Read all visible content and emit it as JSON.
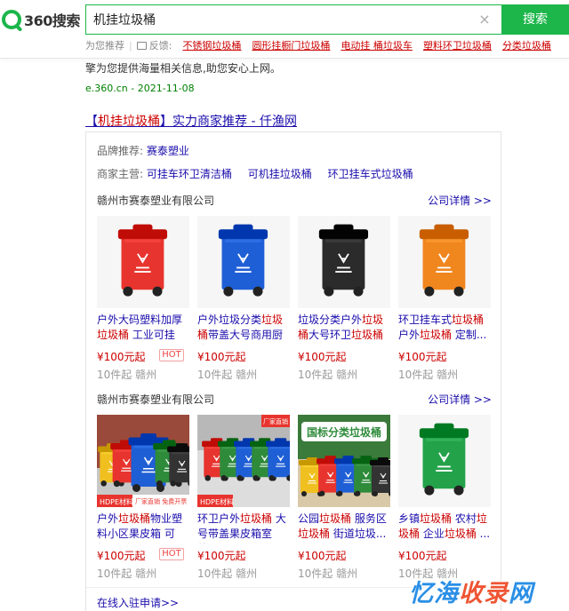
{
  "brand": {
    "logo_text": "360搜索",
    "accent": "#1cb64a"
  },
  "search": {
    "query": "机挂垃圾桶",
    "button_label": "搜索",
    "clear_glyph": "×"
  },
  "suggest": {
    "label": "为您推荐",
    "separator": "|",
    "feedback_label": "反馈:",
    "items": [
      "不锈钢垃圾桶",
      "圆形挂橱门垃圾桶",
      "电动挂 桶垃圾车",
      "塑料环卫垃圾桶",
      "分类垃圾桶"
    ]
  },
  "previous_result": {
    "snippet_line1": "大了机挂垃圾桶,已经为您筛选出更多优质商家信息。360搜索,300精。国内安全的搜索引",
    "snippet_line2": "擎为您提供海量相关信息,助您安心上网。",
    "url": "e.360.cn - 2021-11-08"
  },
  "result": {
    "title_prefix": "【",
    "title_keyword": "机挂垃圾桶",
    "title_suffix": "】实力商家推荐 - 仟渔网",
    "brand_label": "品牌推荐:",
    "brand_value": "赛泰塑业",
    "business_label": "商家主营:",
    "business_items": [
      "可挂车环卫清洁桶",
      "可机挂垃圾桶",
      "环卫挂车式垃圾桶"
    ],
    "footer_link": "在线入驻申请>>"
  },
  "companies": [
    {
      "name": "赣州市赛泰塑业有限公司",
      "more": "公司详情 >>",
      "products": [
        {
          "title_a": "户外大码塑料加厚垃圾桶 工业可挂车...",
          "price": "¥100元起",
          "hot": "HOT",
          "location": "10件起 赣州",
          "color": "#e8342e",
          "image": "bin"
        },
        {
          "title_a": "户外垃圾分类垃圾桶带盖大号商用厨余...",
          "price": "¥100元起",
          "hot": "",
          "location": "10件起 赣州",
          "color": "#1f5fd6",
          "image": "bin"
        },
        {
          "title_a": "垃圾分类户外垃圾桶大号环卫垃圾桶 ...",
          "price": "¥100元起",
          "hot": "",
          "location": "10件起 赣州",
          "color": "#2b2b2b",
          "image": "bin"
        },
        {
          "title_a": "环卫挂车式垃圾桶户外垃圾桶 定制...",
          "price": "¥100元起",
          "hot": "",
          "location": "10件起 赣州",
          "color": "#f0861e",
          "image": "bin"
        }
      ]
    },
    {
      "name": "赣州市赛泰塑业有限公司",
      "more": "公司详情 >>",
      "products": [
        {
          "title_a": "户外垃圾桶物业塑料小区果皮箱 可机...",
          "price": "¥100元起",
          "hot": "HOT",
          "location": "10件起 赣州",
          "color": "#1f5fd6",
          "image": "group",
          "tag": "HDPE材料",
          "tag2": "厂家直销 免费开票"
        },
        {
          "title_a": "环卫户外垃圾桶 大号带盖果皮箱室外...",
          "price": "¥100元起",
          "hot": "",
          "location": "10件起 赣州",
          "color": "#2e8b3a",
          "image": "group2",
          "tag": "HDPE材料",
          "tag2": "厂家直销"
        },
        {
          "title_a": "公园垃圾桶 服务区垃圾桶 街道垃圾...",
          "price": "¥100元起",
          "hot": "",
          "location": "10件起 赣州",
          "color": "#2e9b3a",
          "image": "group3",
          "banner": "国标分类垃圾桶"
        },
        {
          "title_a": "乡镇垃圾桶 农村垃圾桶 企业垃圾桶 ...",
          "price": "¥100元起",
          "hot": "",
          "location": "10件起 赣州",
          "color": "#23a24a",
          "image": "bin"
        }
      ]
    }
  ],
  "watermark": {
    "part1": "忆海",
    "part2": "收录",
    "part3": "网"
  }
}
